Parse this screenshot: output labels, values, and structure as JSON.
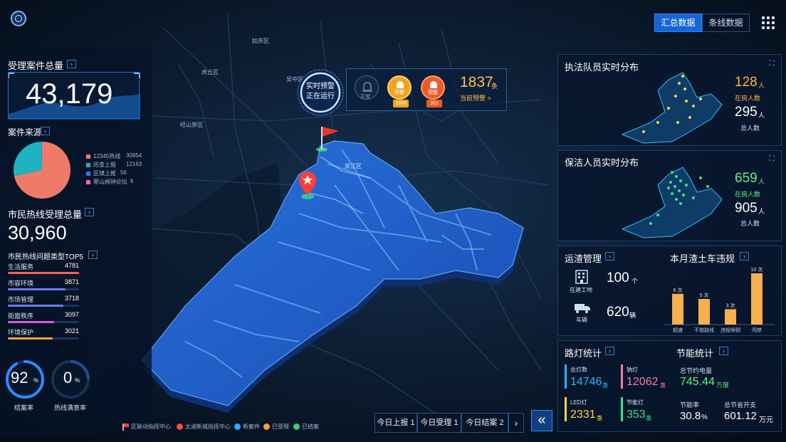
{
  "header": {
    "tabs": [
      {
        "label": "汇总数据",
        "active": true
      },
      {
        "label": "条线数据",
        "active": false
      }
    ],
    "grid_icon": "grid-menu-icon",
    "logo_icon": "globe-logo-icon"
  },
  "map": {
    "district_labels": [
      "姑苏区",
      "虎丘区",
      "吴中区",
      "旺山景区",
      "吴江区"
    ],
    "legend": [
      {
        "label": "区联动指挥中心",
        "color": "#ff3d3d"
      },
      {
        "label": "太湖新城指挥中心",
        "color": "#ff4b3a"
      },
      {
        "label": "新案件",
        "color": "#2fa8ff"
      },
      {
        "label": "已受理",
        "color": "#ff9b2f"
      },
      {
        "label": "已结案",
        "color": "#34d06a"
      }
    ]
  },
  "warning": {
    "ring_line1": "实时预警",
    "ring_line2": "正在运行",
    "normal_label": "正常",
    "alerts": [
      {
        "label": "预警",
        "count": "1486",
        "color": "#f3a21b"
      },
      {
        "label": "预警",
        "count": "351",
        "color": "#ef5a24"
      }
    ],
    "total": "1837",
    "total_unit": "条",
    "current_link": "当前预警 >"
  },
  "left": {
    "cases_title": "受理案件总量",
    "cases_total": "43,179",
    "source_title": "案件来源",
    "pie_legend": [
      {
        "label": "12345热线",
        "value": "30954",
        "color": "#f07a6a"
      },
      {
        "label": "巡查上报",
        "value": "12163",
        "color": "#1fb3c2"
      },
      {
        "label": "区镇上推",
        "value": "56",
        "color": "#3f6df2"
      },
      {
        "label": "寒山闻钟论坛",
        "value": "6",
        "color": "#ef6ab0"
      }
    ],
    "hotline_title": "市民热线受理总量",
    "hotline_total": "30,960",
    "top5_title": "市民热线问题类型TOP5",
    "top5": [
      {
        "label": "生活服务",
        "value": "4781",
        "pct": 1.0,
        "color": "#f0665a"
      },
      {
        "label": "市容环境",
        "value": "3871",
        "pct": 0.81,
        "color": "#6a7cff"
      },
      {
        "label": "市场管理",
        "value": "3718",
        "pct": 0.78,
        "color": "#6a7cff"
      },
      {
        "label": "街面秩序",
        "value": "3097",
        "pct": 0.65,
        "color": "#d95ae0"
      },
      {
        "label": "环境保护",
        "value": "3021",
        "pct": 0.63,
        "color": "#f2a63c"
      }
    ],
    "gauges": [
      {
        "value": "92",
        "unit": "%",
        "label": "结案率",
        "fraction": 0.92
      },
      {
        "value": "0",
        "unit": "%",
        "label": "热线满意率",
        "fraction": 0.0
      }
    ]
  },
  "right": {
    "officers": {
      "title": "执法队员实时分布",
      "active_count": "128",
      "unit": "人",
      "active_label": "在岗人数",
      "total_count": "295",
      "total_label": "总人数"
    },
    "cleaners": {
      "title": "保洁人员实时分布",
      "active_count": "659",
      "unit": "人",
      "active_label": "在岗人数",
      "total_count": "905",
      "total_label": "总人数"
    },
    "transport": {
      "title": "运渣管理",
      "sites_value": "100",
      "sites_unit": "个",
      "sites_label": "在建工地",
      "vehicles_value": "620",
      "vehicles_unit": "辆",
      "vehicles_label": "车辆"
    },
    "violations": {
      "title": "本月渣土车违规"
    },
    "streetlights": {
      "title": "路灯统计",
      "items": [
        {
          "label": "总灯数",
          "value": "14746",
          "unit": "盏",
          "color": "#29b6ff"
        },
        {
          "label": "钠灯",
          "value": "12062",
          "unit": "盏",
          "color": "#ff7aa8"
        },
        {
          "label": "LED灯",
          "value": "2331",
          "unit": "盏",
          "color": "#ffd34a"
        },
        {
          "label": "节能灯",
          "value": "353",
          "unit": "盏",
          "color": "#3ee08a"
        }
      ]
    },
    "energy": {
      "title": "节能统计",
      "saved_label": "总节约电量",
      "saved_value": "745.44",
      "saved_unit": "万度",
      "rate_label": "节能率",
      "rate_value": "30.8",
      "rate_unit": "%",
      "cost_label": "总节省开支",
      "cost_value": "601.12",
      "cost_unit": "万元"
    }
  },
  "bottom": {
    "today": [
      {
        "label": "今日上报 1"
      },
      {
        "label": "今日受理 1"
      },
      {
        "label": "今日结案 2"
      }
    ],
    "next_arrow": "›",
    "collapse_icon": "«"
  },
  "colors": {
    "accent_blue": "#2b8cff",
    "orange": "#ffb347",
    "green": "#5df08a"
  },
  "chart_data": {
    "type": "bar",
    "title": "本月渣土车违规",
    "categories": [
      "超速",
      "不按路线",
      "违规倾倒",
      "闯禁"
    ],
    "values": [
      6,
      5,
      3,
      10
    ],
    "value_labels": [
      "6 次",
      "5 次",
      "3 次",
      "10 次"
    ],
    "ylim": [
      0,
      10
    ]
  }
}
